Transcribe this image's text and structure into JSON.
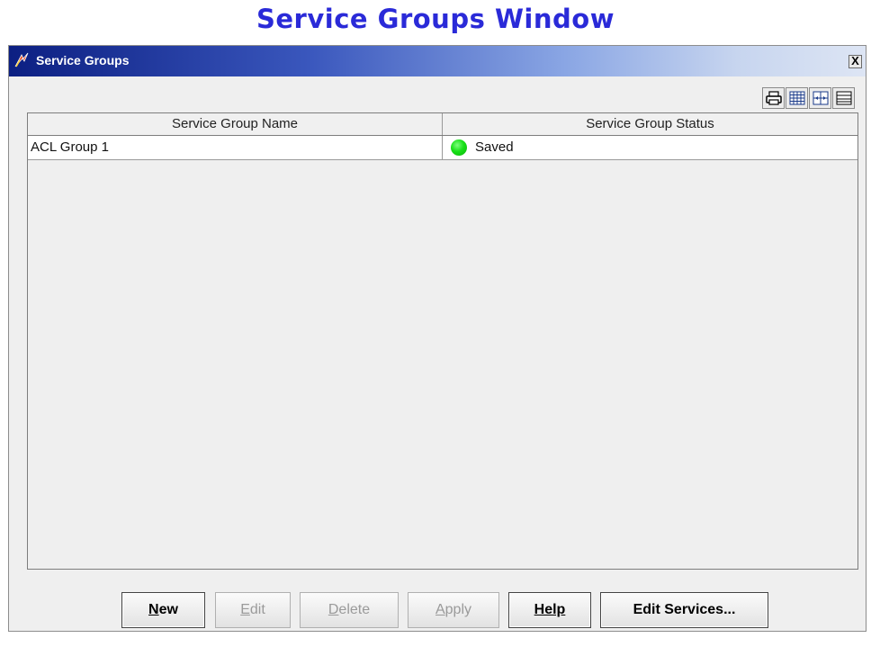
{
  "caption": "Service Groups Window",
  "window": {
    "title": "Service Groups",
    "close_label": "X"
  },
  "toolbar": {
    "icons": [
      "printer-icon",
      "grid-table-icon",
      "fit-columns-icon",
      "row-layout-icon"
    ]
  },
  "table": {
    "columns": [
      "Service Group Name",
      "Service Group Status"
    ],
    "rows": [
      {
        "name": "ACL Group 1",
        "status": "Saved",
        "status_color": "#19d819"
      }
    ]
  },
  "buttons": {
    "new": {
      "label": "New",
      "mnemonic": "N",
      "rest": "ew",
      "enabled": true
    },
    "edit": {
      "label": "Edit",
      "mnemonic": "E",
      "rest": "dit",
      "enabled": false
    },
    "delete": {
      "label": "Delete",
      "mnemonic": "D",
      "rest": "elete",
      "enabled": false
    },
    "apply": {
      "label": "Apply",
      "mnemonic": "A",
      "rest": "pply",
      "enabled": false
    },
    "help": {
      "label": "Help",
      "mnemonic": "Help",
      "rest": "",
      "enabled": true
    },
    "edit_services": {
      "label": "Edit Services...",
      "enabled": true
    }
  },
  "colors": {
    "titlebar_start": "#0c1f82",
    "titlebar_end": "#dde5f4",
    "caption": "#2a2ad8",
    "window_bg": "#efefef"
  }
}
